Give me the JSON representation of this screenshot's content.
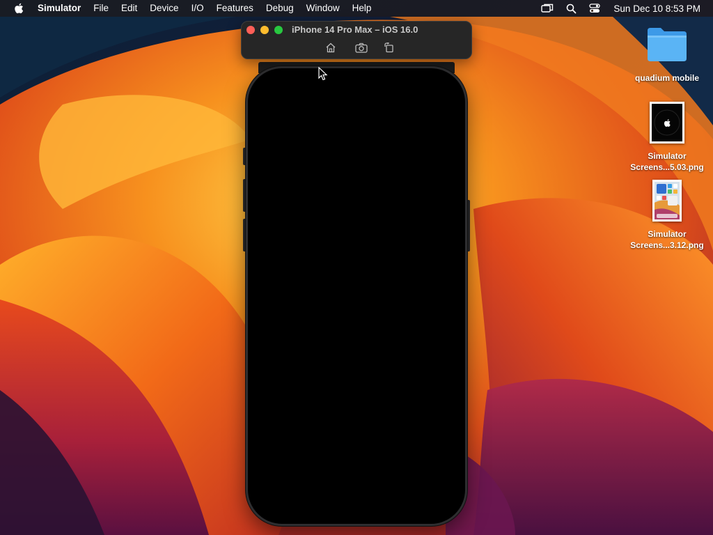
{
  "menubar": {
    "apple_icon": "apple-logo-icon",
    "app_name": "Simulator",
    "items": [
      "File",
      "Edit",
      "Device",
      "I/O",
      "Features",
      "Debug",
      "Window",
      "Help"
    ],
    "status_icons": [
      "screen-mirroring-icon",
      "spotlight-search-icon",
      "control-center-icon"
    ],
    "clock": "Sun Dec 10  8:53 PM"
  },
  "simulator": {
    "title": "iPhone 14 Pro Max – iOS 16.0",
    "toolbar_icons": [
      "home-icon",
      "screenshot-icon",
      "rotate-icon"
    ],
    "screen_state": "blank"
  },
  "desktop": {
    "icons": [
      {
        "label": "quadium mobile",
        "kind": "folder"
      },
      {
        "label_line1": "Simulator",
        "label_line2": "Screens...5.03.png",
        "kind": "image-thumbnail"
      },
      {
        "label_line1": "Simulator",
        "label_line2": "Screens...3.12.png",
        "kind": "image-thumbnail"
      }
    ]
  },
  "colors": {
    "folder_blue": "#4aa8f0",
    "close": "#ff5f57",
    "minimize": "#febc2e",
    "maximize": "#28c840",
    "wallpaper_orange": "#f7911e",
    "wallpaper_deep": "#7a1a3a"
  }
}
